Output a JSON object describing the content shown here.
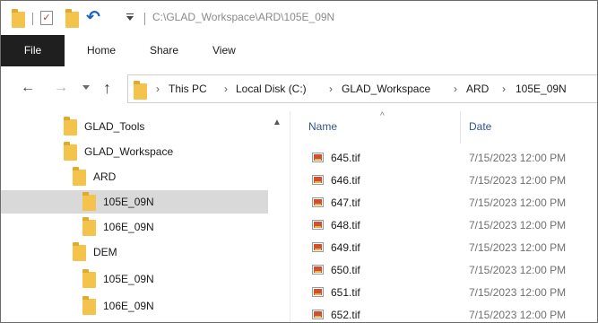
{
  "window": {
    "title": "C:\\GLAD_Workspace\\ARD\\105E_09N",
    "quick_access": [
      "folder-icon",
      "properties-check-icon",
      "new-folder-icon",
      "undo-icon",
      "customize-dropdown-icon"
    ]
  },
  "ribbon": {
    "tabs": [
      "File",
      "Home",
      "Share",
      "View"
    ]
  },
  "address": {
    "crumbs": [
      "This PC",
      "Local Disk (C:)",
      "GLAD_Workspace",
      "ARD",
      "105E_09N"
    ]
  },
  "tree": {
    "items": [
      {
        "label": "GLAD_Tools"
      },
      {
        "label": "GLAD_Workspace"
      },
      {
        "label": "ARD"
      },
      {
        "label": "105E_09N",
        "selected": true
      },
      {
        "label": "106E_09N"
      },
      {
        "label": "DEM"
      },
      {
        "label": "105E_09N"
      },
      {
        "label": "106E_09N"
      }
    ]
  },
  "content": {
    "columns": {
      "name": "Name",
      "date": "Date"
    },
    "files": [
      {
        "name": "645.tif",
        "date": "7/15/2023 12:00 PM"
      },
      {
        "name": "646.tif",
        "date": "7/15/2023 12:00 PM"
      },
      {
        "name": "647.tif",
        "date": "7/15/2023 12:00 PM"
      },
      {
        "name": "648.tif",
        "date": "7/15/2023 12:00 PM"
      },
      {
        "name": "649.tif",
        "date": "7/15/2023 12:00 PM"
      },
      {
        "name": "650.tif",
        "date": "7/15/2023 12:00 PM"
      },
      {
        "name": "651.tif",
        "date": "7/15/2023 12:00 PM"
      },
      {
        "name": "652.tif",
        "date": "7/15/2023 12:00 PM"
      }
    ]
  },
  "colors": {
    "folder": "#f4c34c",
    "selected_row": "#d9d9d9",
    "file_tab": "#1f1f1f",
    "column_header": "#30568a"
  }
}
